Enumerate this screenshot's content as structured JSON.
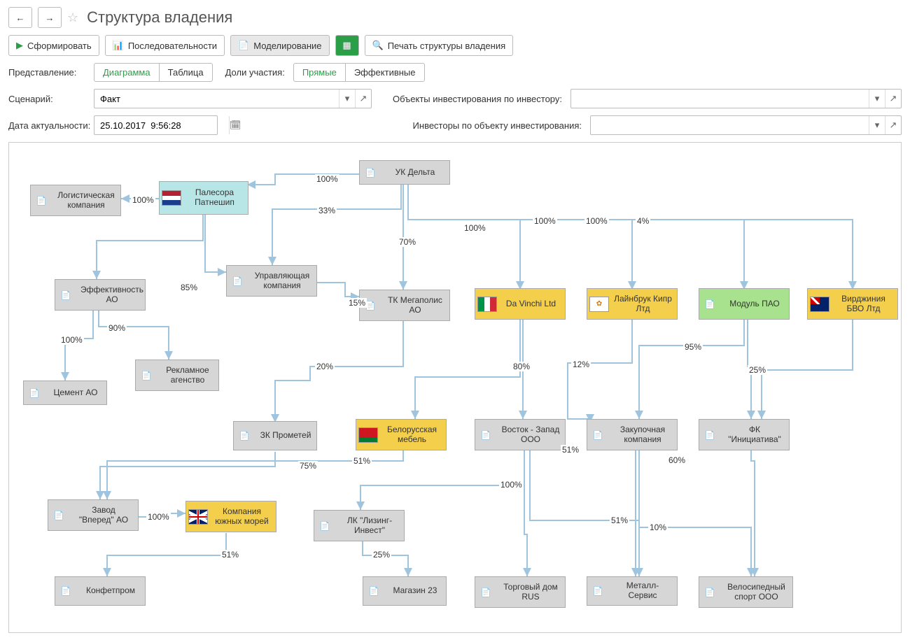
{
  "title": "Структура владения",
  "toolbar": {
    "generate": "Сформировать",
    "sequences": "Последовательности",
    "modeling": "Моделирование",
    "print": "Печать структуры владения"
  },
  "view": {
    "label": "Представление:",
    "diagram": "Диаграмма",
    "table": "Таблица"
  },
  "shares": {
    "label": "Доли участия:",
    "direct": "Прямые",
    "effective": "Эффективные"
  },
  "scenario": {
    "label": "Сценарий:",
    "value": "Факт"
  },
  "objects": {
    "label": "Объекты инвестирования по инвестору:"
  },
  "date": {
    "label": "Дата актуальности:",
    "value": "25.10.2017  9:56:28"
  },
  "investors": {
    "label": "Инвесторы по объекту инвестирования:"
  },
  "nodes": {
    "uk_delta": "УК Дельта",
    "palesora": "Палесора Патнешип",
    "logist": "Логистическая компания",
    "effekt": "Эффективность АО",
    "uprav": "Управляющая компания",
    "reklam": "Рекламное агенство",
    "cement": "Цемент АО",
    "tk_mega": "ТК Мегаполис АО",
    "davinci": "Da Vinchi Ltd",
    "lainbruk": "Лайнбрук Кипр Лтд",
    "modul": "Модуль ПАО",
    "virgin": "Вирджиния БВО Лтд",
    "prometey": "ЗК Прометей",
    "belarus": "Белорусская мебель",
    "vostok": "Восток - Запад ООО",
    "zakup": "Закупочная компания",
    "fk_init": "ФК \"Инициатива\"",
    "zavod": "Завод \"Вперед\" АО",
    "uk_seas": "Компания южных морей",
    "lizing": "ЛК \"Лизинг-Инвест\"",
    "konfet": "Конфетпром",
    "magazin": "Магазин 23",
    "torg_rus": "Торговый дом RUS",
    "metall": "Металл-Сервис",
    "velo": "Велосипедный спорт ООО"
  },
  "pcts": {
    "p1": "100%",
    "p2": "100%",
    "p3": "33%",
    "p4": "70%",
    "p5": "100%",
    "p6": "100%",
    "p7": "100%",
    "p8": "4%",
    "p9": "85%",
    "p10": "15%",
    "p11": "90%",
    "p12": "100%",
    "p13": "20%",
    "p14": "80%",
    "p15": "12%",
    "p16": "95%",
    "p17": "25%",
    "p18": "51%",
    "p19": "51%",
    "p20": "75%",
    "p21": "60%",
    "p22": "100%",
    "p23": "100%",
    "p24": "51%",
    "p25": "10%",
    "p26": "51%",
    "p27": "25%"
  }
}
